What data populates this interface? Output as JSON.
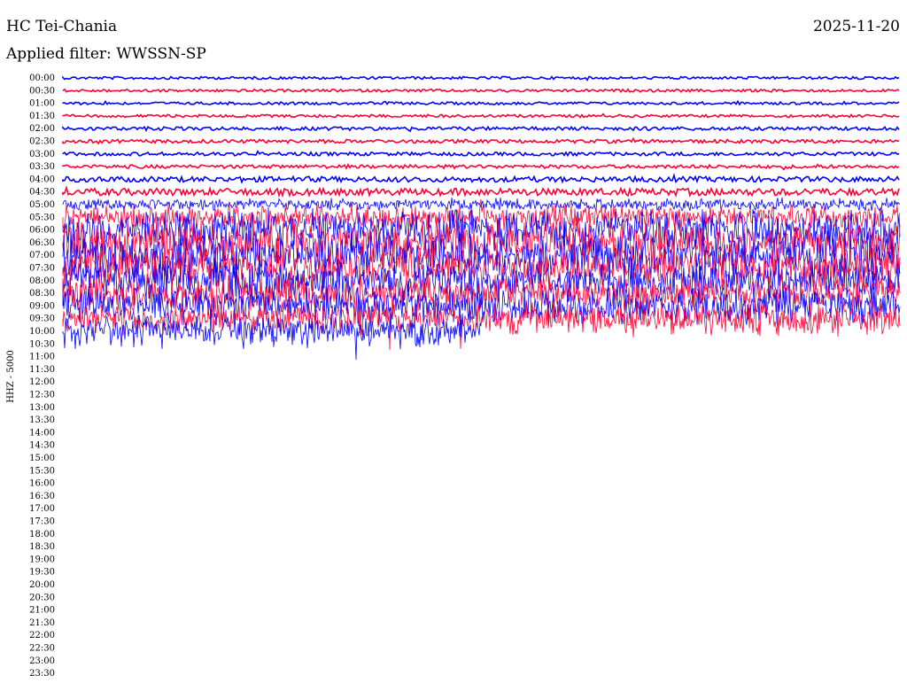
{
  "header": {
    "station": "HC Tei-Chania",
    "date": "2025-11-20",
    "filter": "Applied filter: WWSSN-SP"
  },
  "chart_data": {
    "type": "line",
    "title": "HC Tei-Chania",
    "channel_label": "HHZ - 5000",
    "trace_colors": [
      "#0000ff",
      "#ff0033"
    ],
    "rows": [
      {
        "time": "00:00",
        "amp": 1.5,
        "data": true
      },
      {
        "time": "00:30",
        "amp": 1.5,
        "data": true
      },
      {
        "time": "01:00",
        "amp": 1.5,
        "data": true
      },
      {
        "time": "01:30",
        "amp": 1.5,
        "data": true
      },
      {
        "time": "02:00",
        "amp": 2,
        "data": true
      },
      {
        "time": "02:30",
        "amp": 2,
        "data": true
      },
      {
        "time": "03:00",
        "amp": 2,
        "data": true
      },
      {
        "time": "03:30",
        "amp": 2,
        "data": true
      },
      {
        "time": "04:00",
        "amp": 3,
        "data": true
      },
      {
        "time": "04:30",
        "amp": 4,
        "data": true
      },
      {
        "time": "05:00",
        "amp": 6,
        "data": true
      },
      {
        "time": "05:30",
        "amp": 12,
        "data": true
      },
      {
        "time": "06:00",
        "amp": 20,
        "data": true
      },
      {
        "time": "06:30",
        "amp": 22,
        "data": true
      },
      {
        "time": "07:00",
        "amp": 22,
        "data": true
      },
      {
        "time": "07:30",
        "amp": 20,
        "data": true
      },
      {
        "time": "08:00",
        "amp": 20,
        "data": true
      },
      {
        "time": "08:30",
        "amp": 18,
        "data": true
      },
      {
        "time": "09:00",
        "amp": 18,
        "data": true
      },
      {
        "time": "09:30",
        "amp": 16,
        "data": true
      },
      {
        "time": "10:00",
        "amp": 16,
        "data": true,
        "end_fraction": 0.5
      },
      {
        "time": "10:30",
        "amp": 0,
        "data": false
      },
      {
        "time": "11:00",
        "amp": 0,
        "data": false
      },
      {
        "time": "11:30",
        "amp": 0,
        "data": false
      },
      {
        "time": "12:00",
        "amp": 0,
        "data": false
      },
      {
        "time": "12:30",
        "amp": 0,
        "data": false
      },
      {
        "time": "13:00",
        "amp": 0,
        "data": false
      },
      {
        "time": "13:30",
        "amp": 0,
        "data": false
      },
      {
        "time": "14:00",
        "amp": 0,
        "data": false
      },
      {
        "time": "14:30",
        "amp": 0,
        "data": false
      },
      {
        "time": "15:00",
        "amp": 0,
        "data": false
      },
      {
        "time": "15:30",
        "amp": 0,
        "data": false
      },
      {
        "time": "16:00",
        "amp": 0,
        "data": false
      },
      {
        "time": "16:30",
        "amp": 0,
        "data": false
      },
      {
        "time": "17:00",
        "amp": 0,
        "data": false
      },
      {
        "time": "17:30",
        "amp": 0,
        "data": false
      },
      {
        "time": "18:00",
        "amp": 0,
        "data": false
      },
      {
        "time": "18:30",
        "amp": 0,
        "data": false
      },
      {
        "time": "19:00",
        "amp": 0,
        "data": false
      },
      {
        "time": "19:30",
        "amp": 0,
        "data": false
      },
      {
        "time": "20:00",
        "amp": 0,
        "data": false
      },
      {
        "time": "20:30",
        "amp": 0,
        "data": false
      },
      {
        "time": "21:00",
        "amp": 0,
        "data": false
      },
      {
        "time": "21:30",
        "amp": 0,
        "data": false
      },
      {
        "time": "22:00",
        "amp": 0,
        "data": false
      },
      {
        "time": "22:30",
        "amp": 0,
        "data": false
      },
      {
        "time": "23:00",
        "amp": 0,
        "data": false
      },
      {
        "time": "23:30",
        "amp": 0,
        "data": false
      }
    ]
  }
}
